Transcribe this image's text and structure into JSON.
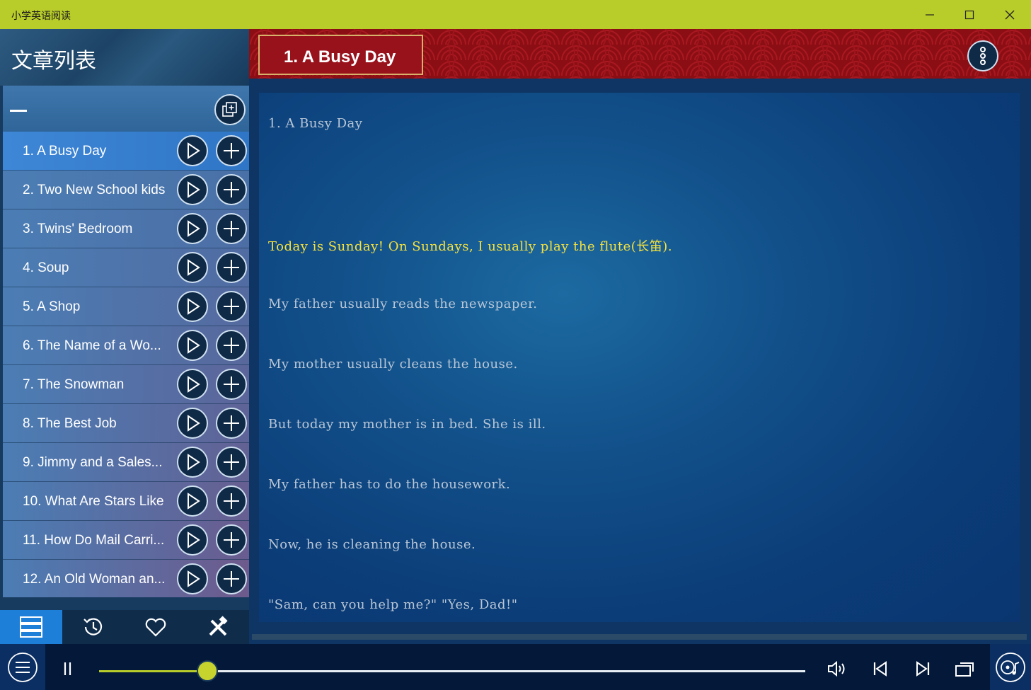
{
  "window": {
    "title": "小学英语阅读"
  },
  "sidebar": {
    "heading": "文章列表",
    "items": [
      {
        "label": "1. A Busy Day"
      },
      {
        "label": "2. Two New School kids"
      },
      {
        "label": "3. Twins' Bedroom"
      },
      {
        "label": "4. Soup"
      },
      {
        "label": "5. A Shop"
      },
      {
        "label": "6. The Name of a Wo..."
      },
      {
        "label": "7. The Snowman"
      },
      {
        "label": "8. The Best Job"
      },
      {
        "label": "9. Jimmy and a Sales..."
      },
      {
        "label": "10. What Are Stars Like"
      },
      {
        "label": "11. How Do Mail Carri..."
      },
      {
        "label": "12. An Old Woman an..."
      }
    ],
    "tabs": [
      "list-icon",
      "history-icon",
      "heart-icon",
      "tools-icon"
    ]
  },
  "article": {
    "banner_title": "1. A Busy Day",
    "lines": [
      {
        "text": "1.  A Busy Day"
      },
      {
        "text": "Today is Sunday! On Sundays, I usually play the flute(长笛)."
      },
      {
        "text": "My father usually reads the newspaper."
      },
      {
        "text": "My mother usually cleans the house."
      },
      {
        "text": "But today my mother is in bed. She is ill."
      },
      {
        "text": "My father has to do the housework."
      },
      {
        "text": "Now, he is cleaning the house."
      },
      {
        "text": "\"Sam, can you help me?\" \"Yes, Dad!\""
      }
    ]
  },
  "player": {
    "progress": 0.153
  },
  "colors": {
    "accent": "#b8cc2a",
    "highlight": "#f6e23c",
    "active_tab": "#1e7fd8"
  }
}
